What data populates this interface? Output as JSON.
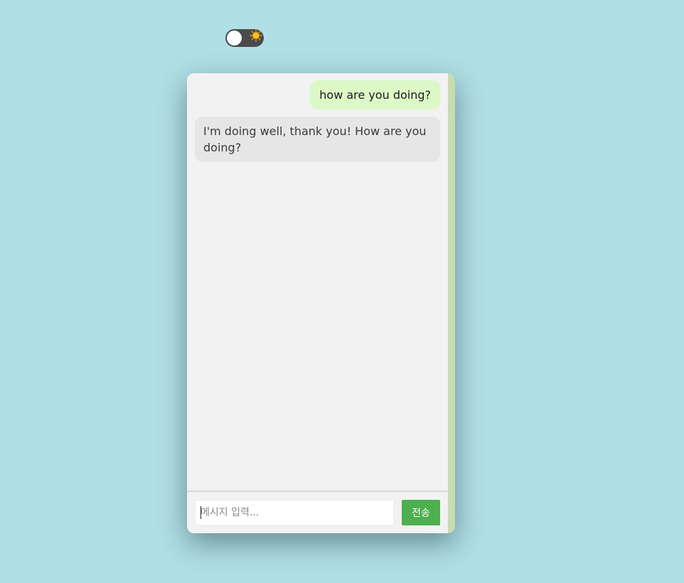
{
  "theme_toggle": {
    "state": "light",
    "icon": "sun-icon",
    "track_color": "#4a4a4a",
    "sun_color": "#f7c21a"
  },
  "chat": {
    "messages": [
      {
        "role": "user",
        "text": "how are you doing?"
      },
      {
        "role": "bot",
        "text": "I'm doing well, thank you! How are you doing?"
      }
    ],
    "colors": {
      "user_bubble": "#dcf8c6",
      "bot_bubble": "#e6e6e6",
      "background": "#f2f2f2",
      "page_background": "#b0dfe5"
    }
  },
  "input": {
    "placeholder": "메시지 입력...",
    "value": ""
  },
  "send_button": {
    "label": "전송",
    "color": "#4caf50"
  }
}
